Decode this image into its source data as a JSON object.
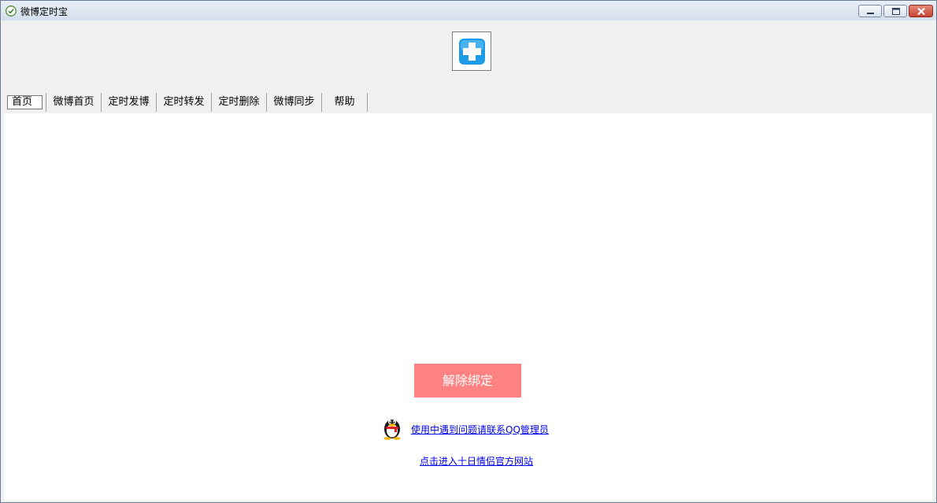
{
  "window": {
    "title": "微博定时宝"
  },
  "tabs": [
    {
      "label": "首页",
      "active": true
    },
    {
      "label": "微博首页",
      "active": false
    },
    {
      "label": "定时发博",
      "active": false
    },
    {
      "label": "定时转发",
      "active": false
    },
    {
      "label": "定时删除",
      "active": false
    },
    {
      "label": "微博同步",
      "active": false
    },
    {
      "label": "帮助",
      "active": false
    }
  ],
  "main": {
    "unbind_label": "解除绑定",
    "qq_contact_link": "使用中遇到问题请联系QQ管理员",
    "official_site_link": "点击进入十日情侣官方网站"
  },
  "icons": {
    "app": "clock-check-icon",
    "logo": "plus-cross-icon",
    "contact": "qq-penguin-icon"
  },
  "colors": {
    "unbind_button": "#fe8281",
    "link": "#0000ee",
    "logo_blue": "#1e9be8"
  }
}
